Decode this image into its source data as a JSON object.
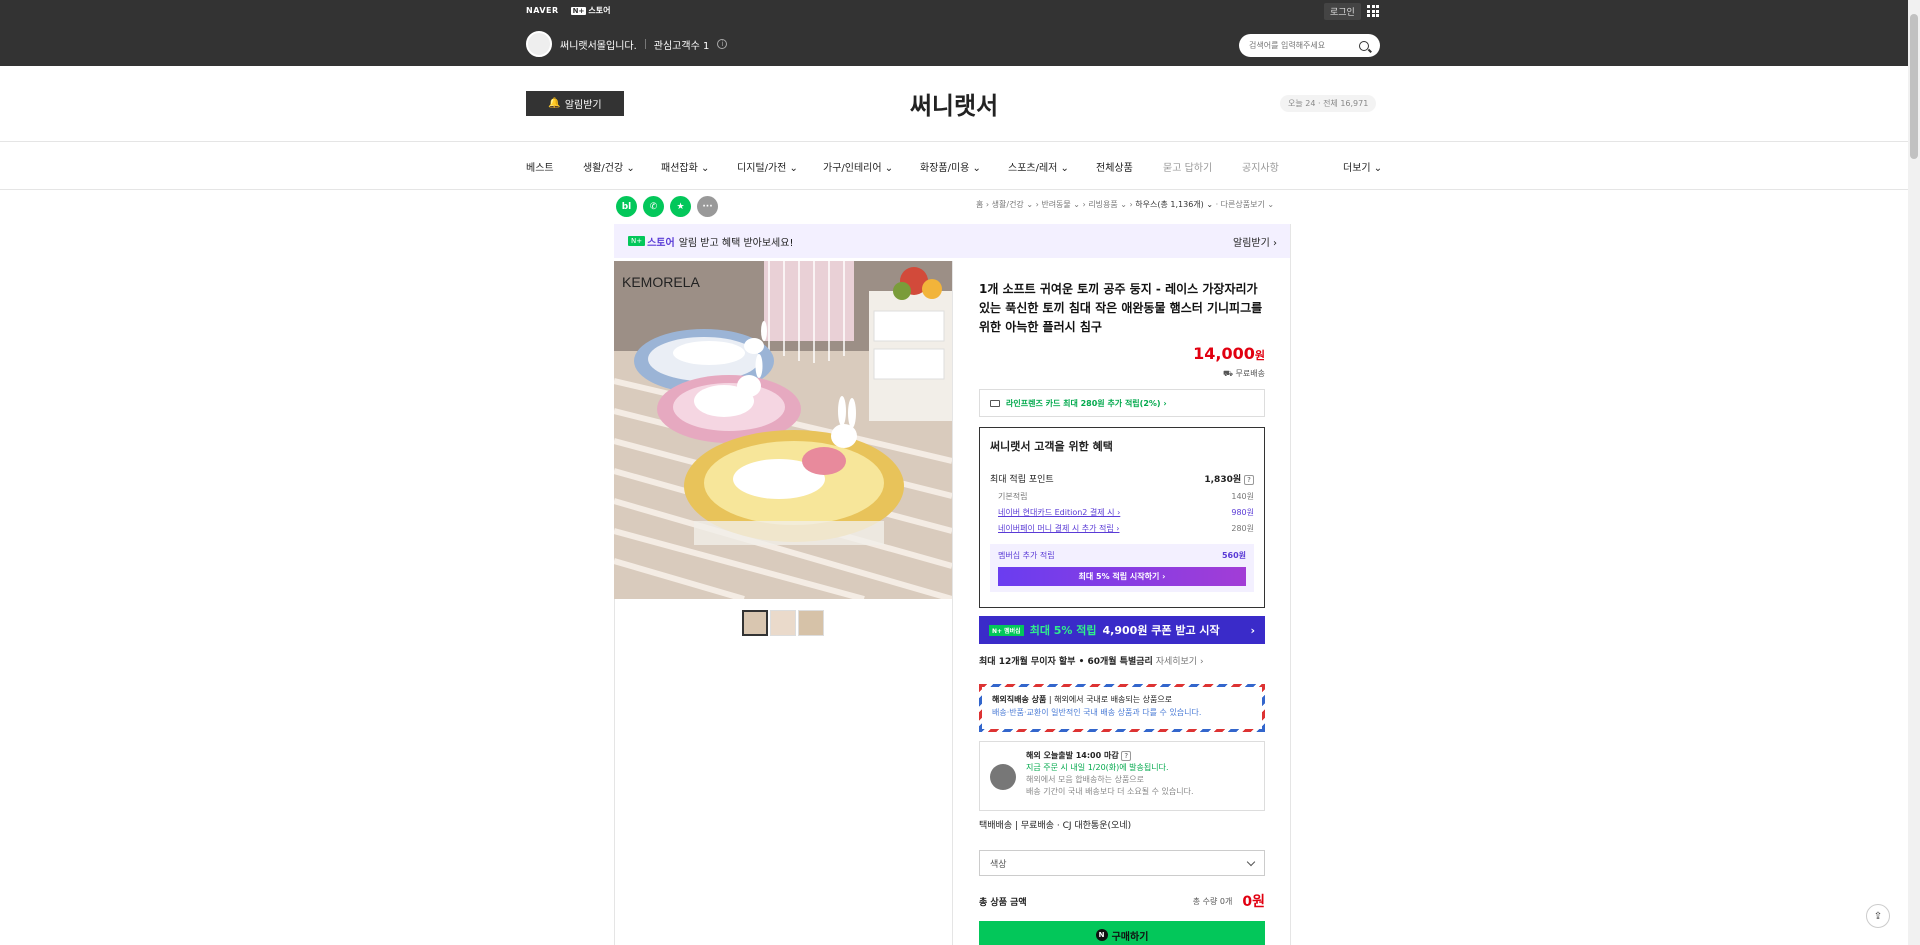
{
  "topbar": {
    "naver": "NAVER",
    "store_mark": "N+",
    "store_label": "스토어",
    "login": "로그인",
    "seller_name": "써니랫서몰입니다.",
    "followers": "관심고객수 1",
    "info": "i",
    "search_placeholder": "검색어를 입력해주세요"
  },
  "header": {
    "alarm_label": "알림받기",
    "store_title": "써니랫서",
    "visits": "오늘 24 · 전체 16,971"
  },
  "nav": {
    "items": [
      "베스트",
      "생활/건강 ⌄",
      "패션잡화 ⌄",
      "디지털/가전 ⌄",
      "가구/인테리어 ⌄",
      "화장품/미용 ⌄",
      "스포츠/레저 ⌄",
      "전체상품",
      "묻고 답하기",
      "공지사항",
      "더보기 ⌄"
    ]
  },
  "icons": {
    "blog": "bl",
    "talk": "✆",
    "bookmark": "★",
    "more": "···"
  },
  "breadcrumb": {
    "parts": [
      "홈 ›",
      "생활/건강 ⌄ ›",
      "반려동물 ⌄ ›",
      "리빙용품 ⌄ ›"
    ],
    "current": "하우스(총 1,136개) ⌄",
    "more": "· 다른상품보기 ⌄"
  },
  "promo": {
    "badge": "N+",
    "store": "스토어",
    "text": "알림 받고 혜택 받아보세요!",
    "right": "알림받기 ›"
  },
  "product": {
    "img_brand": "KEMORELA",
    "title": "1개 소프트 귀여운 토끼 공주 둥지 - 레이스 가장자리가 있는 푹신한 토끼 침대 작은 애완동물 햄스터 기니피그를 위한 아늑한 플러시 침구",
    "price": "14,000",
    "price_unit": "원",
    "shipping": "무료배송",
    "card_benefit": "라인프렌즈 카드 최대 280원 추가 적립(2%) ›"
  },
  "benefit": {
    "title": "써니랫서 고객을 위한 혜택",
    "max_label": "최대 적립 포인트",
    "max_value": "1,830원",
    "help": "?",
    "rows": [
      {
        "label": "기본적립",
        "value": "140원"
      },
      {
        "label": "네이버 현대카드 Edition2 결제 시 ›",
        "value": "980원"
      },
      {
        "label": "네이버페이 머니 결제 시 추가 적립 ›",
        "value": "280원"
      }
    ],
    "member_label": "멤버십 추가 적립",
    "member_value": "560원",
    "member_btn": "최대 5% 적립 시작하기 ›"
  },
  "nplus": {
    "tag": "N+ 멤버십",
    "accent": "최대 5% 적립",
    "text": "4,900원 쿠폰 받고 시작",
    "chev": "›"
  },
  "install": {
    "text": "최대 12개월 무이자 할부 • 60개월 특별금리",
    "link": "자세히보기 ›"
  },
  "overseas": {
    "title": "해외직배송 상품",
    "line1": "해외에서 국내로 배송되는 상품으로",
    "line2": "배송·반품·교환이 일반적인 국내 배송 상품과 다를 수 있습니다."
  },
  "ship": {
    "title": "해외 오늘출발 14:00 마감",
    "line1": "지금 주문 시 내일 1/20(화)에 발송됩니다.",
    "line2": "해외에서 모음 합배송하는 상품으로",
    "line3": "배송 기간이 국내 배송보다 더 소요될 수 있습니다."
  },
  "delivery": "택배배송  |  무료배송 · CJ 대한통운(오네)",
  "select": {
    "label": "색상"
  },
  "total": {
    "label": "총 상품 금액",
    "qty": "총 수량 0개",
    "amount": "0원"
  },
  "buy": {
    "icon": "N",
    "label": "구매하기"
  },
  "share": "⇪"
}
